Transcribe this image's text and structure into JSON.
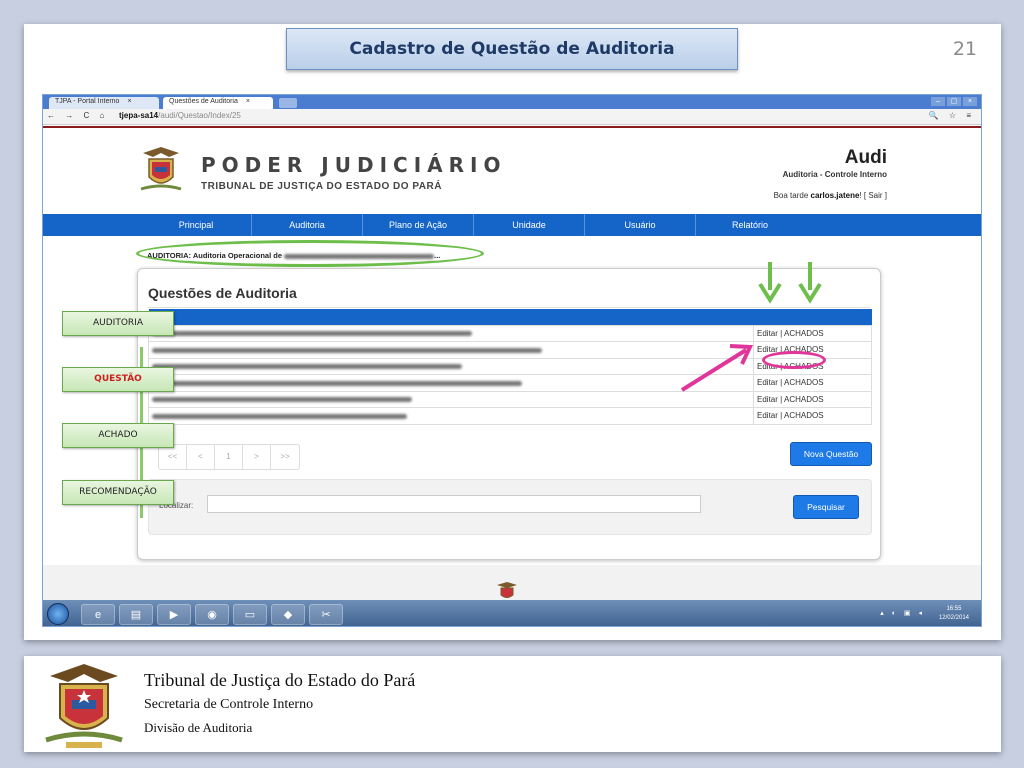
{
  "slide": {
    "title": "Cadastro de Questão de Auditoria",
    "number": "21"
  },
  "browser": {
    "tabs": [
      {
        "label": "TJPA - Portal Interno",
        "close": "×"
      },
      {
        "label": "Questões de Auditoria",
        "close": "×"
      }
    ],
    "nav_icons": "← → C ⌂",
    "url_host": "tjepa-sa14",
    "url_path": "/audi/Questao/Index/25",
    "tool_icons": "🔍 ☆ ≡",
    "window_buttons": [
      "–",
      "▢",
      "×"
    ]
  },
  "header": {
    "org_title": "PODER JUDICIÁRIO",
    "org_subtitle": "TRIBUNAL DE JUSTIÇA DO ESTADO DO PARÁ",
    "app_name": "Audi",
    "app_desc": "Auditoria - Controle Interno",
    "greeting_prefix": "Boa tarde ",
    "user": "carlos.jatene",
    "greeting_suffix": "! [ Sair ]"
  },
  "menu": [
    "Principal",
    "Auditoria",
    "Plano de Ação",
    "Unidade",
    "Usuário",
    "Relatório"
  ],
  "audit_label": "AUDITORIA: Auditoria Operacional de",
  "audit_ellipsis": "...",
  "panel": {
    "title": "Questões de Auditoria",
    "rows": [
      {
        "action": "Editar | ACHADOS"
      },
      {
        "action": "Editar | ACHADOS"
      },
      {
        "action": "Editar | ACHADOS"
      },
      {
        "action": "Editar | ACHADOS"
      },
      {
        "action": "Editar | ACHADOS"
      },
      {
        "action": "Editar | ACHADOS"
      }
    ],
    "pager": [
      "<<",
      "<",
      "1",
      ">",
      ">>"
    ],
    "new_button": "Nova Questão",
    "search_label": "Localizar:",
    "search_button": "Pesquisar"
  },
  "taskbar": {
    "time": "16:55",
    "date": "12/02/2014"
  },
  "overlays": {
    "steps": [
      "AUDITORIA",
      "QUESTÃO",
      "ACHADO",
      "RECOMENDAÇÃO"
    ],
    "highlight_color": "#cc1f1f",
    "arrow_color": "#6dbe4a",
    "pointer_color": "#e0359a"
  },
  "banner": {
    "line1": "Tribunal de Justiça do Estado do  Pará",
    "line2": "Secretaria de Controle Interno",
    "line3": "Divisão de Auditoria"
  }
}
